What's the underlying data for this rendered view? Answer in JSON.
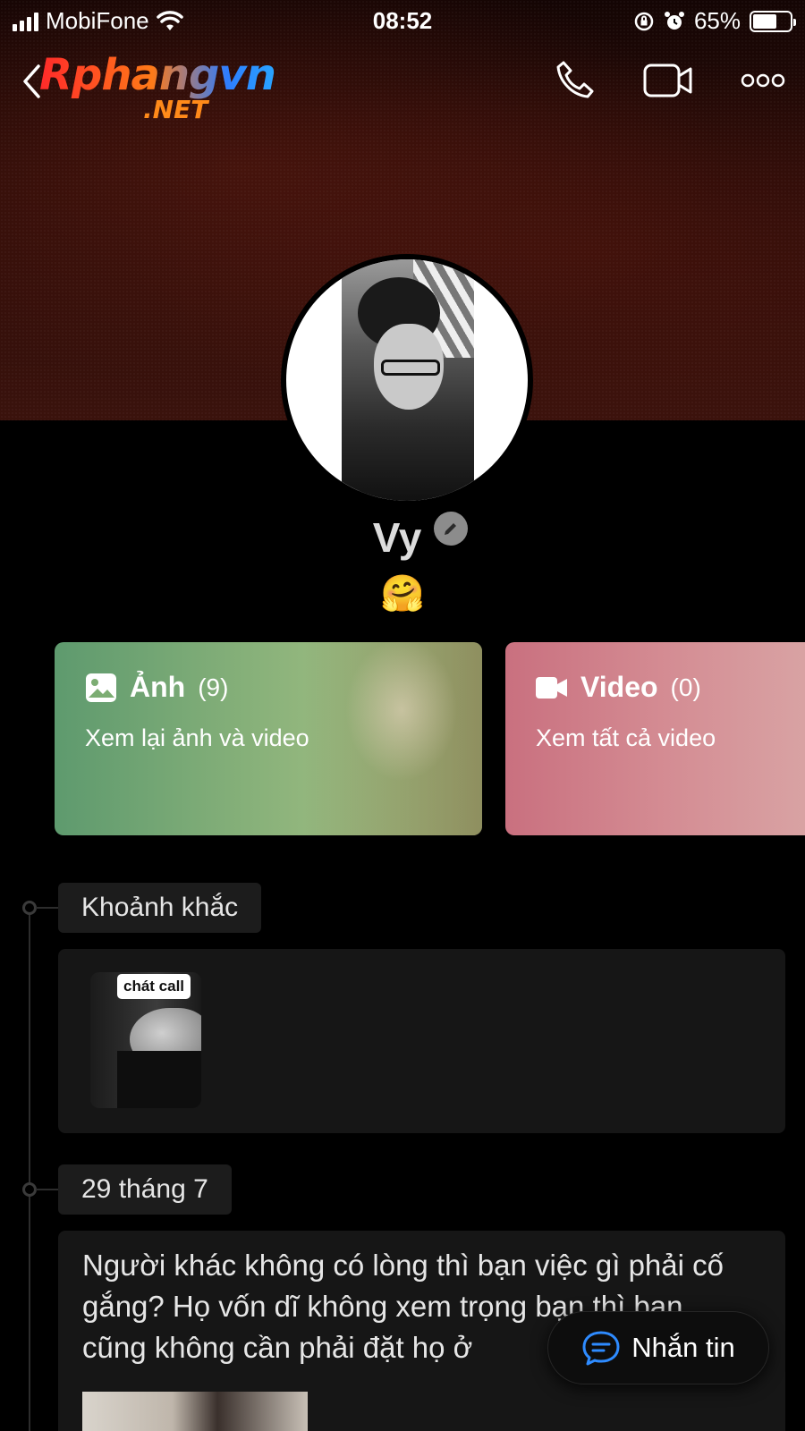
{
  "status_bar": {
    "carrier": "MobiFone",
    "time": "08:52",
    "battery_percent": "65%",
    "battery_level": 0.65
  },
  "header": {
    "logo_main": "Rphangvn",
    "logo_sub": ".NET",
    "icons": [
      "chevron-left-icon",
      "phone-icon",
      "video-camera-icon",
      "more-icon"
    ]
  },
  "profile": {
    "name": "Vy",
    "status_emoji": "🤗"
  },
  "media_cards": [
    {
      "icon": "image-icon",
      "title": "Ảnh",
      "count": "(9)",
      "subtitle": "Xem lại ảnh và video",
      "color": "#6fa572"
    },
    {
      "icon": "video-icon",
      "title": "Video",
      "count": "(0)",
      "subtitle": "Xem tất cả video",
      "color": "#cf7d88"
    }
  ],
  "timeline": {
    "moments_label": "Khoảnh khắc",
    "moment_tag": "chát call",
    "date_label": "29 tháng 7",
    "post_text": "Người khác không có lòng thì bạn việc gì phải cố gắng? Họ vốn dĩ không xem trọng bạn thì bạn cũng không cần phải đặt họ ở"
  },
  "message_button": {
    "label": "Nhắn tin",
    "icon": "chat-bubble-icon",
    "accent": "#2e8bff"
  }
}
